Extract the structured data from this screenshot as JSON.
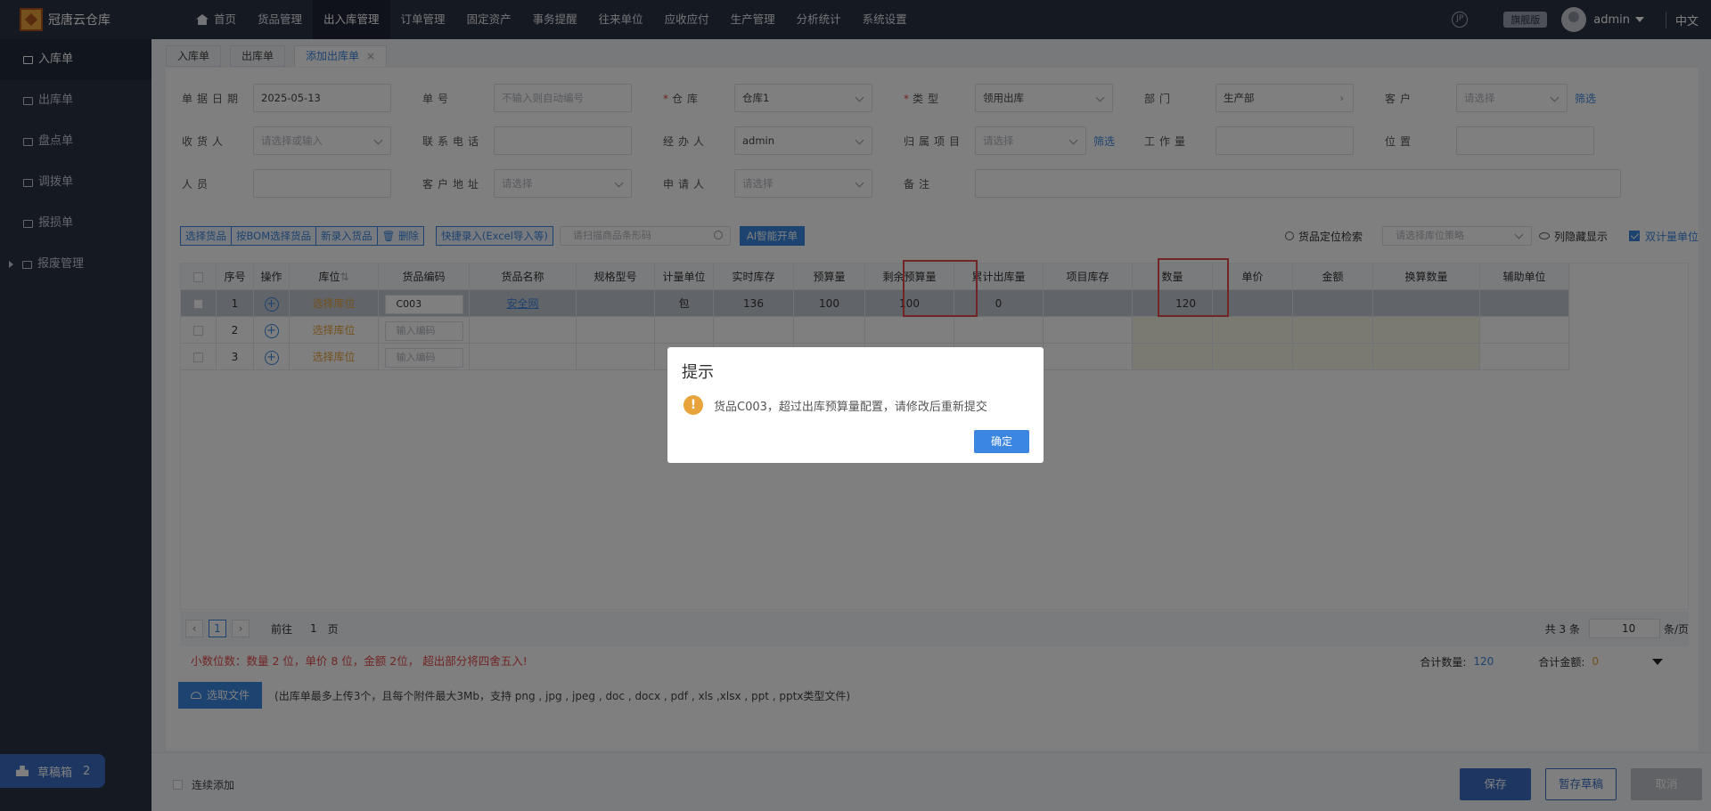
{
  "app": {
    "title": "冠唐云仓库"
  },
  "nav": {
    "items": [
      "首页",
      "货品管理",
      "出入库管理",
      "订单管理",
      "固定资产",
      "事务提醒",
      "往来单位",
      "应收应付",
      "生产管理",
      "分析统计",
      "系统设置"
    ],
    "active_index": 2
  },
  "topright": {
    "circle_icon_text": "JP",
    "edition": "旗舰版",
    "user": "admin",
    "language": "中文"
  },
  "sidebar": {
    "items": [
      "入库单",
      "出库单",
      "盘点单",
      "调拨单",
      "报损单",
      "报废管理"
    ],
    "active_index": 0
  },
  "draft": {
    "label": "草稿箱",
    "count": "2"
  },
  "tabs": [
    {
      "label": "入库单"
    },
    {
      "label": "出库单"
    },
    {
      "label": "添加出库单",
      "closable": true,
      "active": true
    }
  ],
  "form": {
    "row1": [
      {
        "label": "单据日期",
        "value": "2025-05-13",
        "placeholder": false
      },
      {
        "label": "单号",
        "value": "不输入则自动编号",
        "placeholder": true
      },
      {
        "label": "仓库",
        "required": true,
        "value": "仓库1",
        "dropdown": true
      },
      {
        "label": "类型",
        "required": true,
        "value": "领用出库",
        "dropdown": true
      },
      {
        "label": "部门",
        "value": "生产部",
        "arrow": true
      },
      {
        "label": "客户",
        "value": "请选择",
        "placeholder": true,
        "dropdown": true,
        "link": "筛选"
      }
    ],
    "row2": [
      {
        "label": "收货人",
        "value": "请选择或输入",
        "placeholder": true,
        "dropdown": true
      },
      {
        "label": "联系电话",
        "value": ""
      },
      {
        "label": "经办人",
        "value": "admin",
        "dropdown": true
      },
      {
        "label": "归属项目",
        "value": "请选择",
        "placeholder": true,
        "dropdown": true,
        "link": "筛选"
      },
      {
        "label": "工作量",
        "value": ""
      },
      {
        "label": "位置",
        "value": ""
      }
    ],
    "row3": [
      {
        "label": "人员",
        "value": ""
      },
      {
        "label": "客户地址",
        "value": "请选择",
        "placeholder": true,
        "dropdown": true
      },
      {
        "label": "申请人",
        "value": "请选择",
        "placeholder": true,
        "dropdown": true
      },
      {
        "label": "备注",
        "value": ""
      }
    ]
  },
  "toolbar": {
    "buttons": [
      "选择货品",
      "按BOM选择货品",
      "新录入货品",
      "删除"
    ],
    "excel_button": "快捷录入(Excel导入等)",
    "scan_placeholder": "请扫描商品条形码",
    "ai_button": "AI智能开单",
    "locate_label": "货品定位检索",
    "strategy_placeholder": "请选择库位策略",
    "hidden_cols_label": "列隐藏显示",
    "dual_unit_label": "双计量单位"
  },
  "table": {
    "headers": [
      "序号",
      "操作",
      "库位",
      "货品编码",
      "货品名称",
      "规格型号",
      "计量单位",
      "实时库存",
      "预算量",
      "剩余预算量",
      "累计出库量",
      "项目库存",
      "数量",
      "单价",
      "金额",
      "换算数量",
      "辅助单位"
    ],
    "rows": [
      {
        "no": "1",
        "location": "选择库位",
        "code": "C003",
        "name": "安全网",
        "spec": "",
        "unit": "包",
        "stock": "136",
        "budget": "100",
        "remaining": "100",
        "cumulative": "0",
        "project_stock": "",
        "qty": "120",
        "price": "",
        "amount": "",
        "conv_qty": "",
        "aux_unit": ""
      },
      {
        "no": "2",
        "location": "选择库位",
        "code": "输入编码",
        "name": "",
        "spec": "",
        "unit": "",
        "stock": "",
        "budget": "",
        "remaining": "",
        "cumulative": "",
        "project_stock": "",
        "qty": "",
        "price": "",
        "amount": "",
        "conv_qty": "",
        "aux_unit": ""
      },
      {
        "no": "3",
        "location": "选择库位",
        "code": "输入编码",
        "name": "",
        "spec": "",
        "unit": "",
        "stock": "",
        "budget": "",
        "remaining": "",
        "cumulative": "",
        "project_stock": "",
        "qty": "",
        "price": "",
        "amount": "",
        "conv_qty": "",
        "aux_unit": ""
      }
    ]
  },
  "pager": {
    "current": "1",
    "goto_prefix": "前往",
    "goto_value": "1",
    "goto_suffix": "页",
    "total": "共 3 条",
    "page_size": "10",
    "per_page": "条/页"
  },
  "note": "小数位数：数量 2 位，单价 8 位，金额 2位，  超出部分将四舍五入!",
  "summary": {
    "qty_label": "合计数量:",
    "qty_value": "120",
    "amount_label": "合计金额:",
    "amount_value": "0"
  },
  "upload": {
    "button": "选取文件",
    "hint": "(出库单最多上传3个，且每个附件最大3Mb，支持 png , jpg , jpeg , doc , docx , pdf , xls ,xlsx , ppt , pptx类型文件)"
  },
  "footer": {
    "continuous_label": "连续添加",
    "save": "保存",
    "save_draft": "暂存草稿",
    "cancel": "取消"
  },
  "dialog": {
    "title": "提示",
    "message": "货品C003，超过出库预算量配置，请修改后重新提交",
    "ok": "确定"
  },
  "colors": {
    "primary": "#3a86e0",
    "nav_bg": "#2b3245",
    "warning": "#e8a33a",
    "danger": "#e24b4b"
  }
}
